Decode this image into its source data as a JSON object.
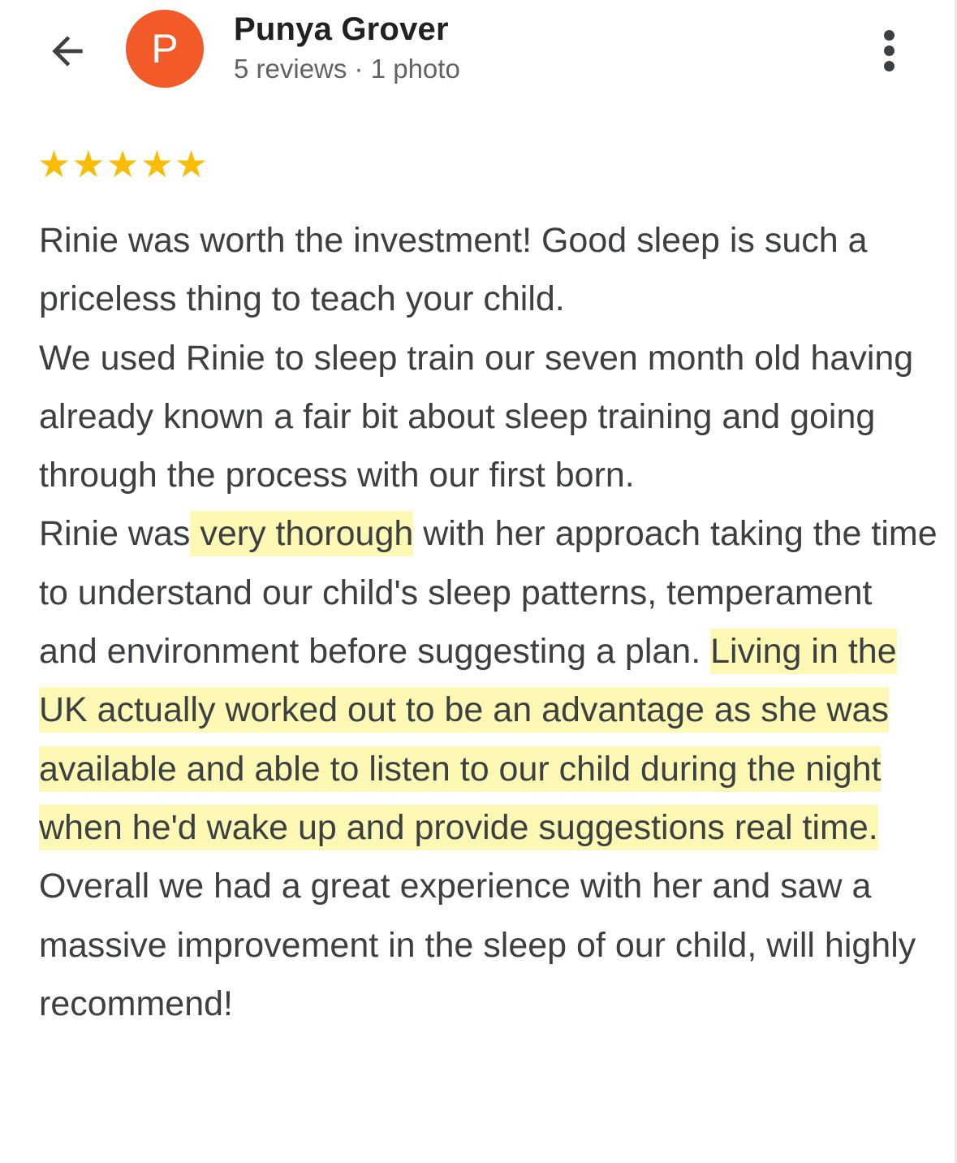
{
  "header": {
    "back_icon": "arrow-left-icon",
    "avatar_letter": "P",
    "avatar_color": "#f25a29",
    "author_name": "Punya Grover",
    "author_meta": "5 reviews · 1 photo",
    "more_icon": "more-vertical-icon"
  },
  "review": {
    "rating": 5,
    "rating_max": 5,
    "star_color": "#fbbc04",
    "highlight_color": "#fdf9b5",
    "p1": "Rinie was worth the investment! Good sleep is such a priceless thing to teach your child.",
    "p2": "We used Rinie to sleep train our seven month old having already known a fair bit about sleep training and going through the process with our first born.",
    "p3_a": "Rinie was",
    "p3_hl1": " very thorough",
    "p3_b": " with her approach taking the time to understand our child's sleep patterns, temperament and environment before suggesting a plan. ",
    "p3_hl2": "Living in the UK actually worked out to be an advantage as she was available and able to listen to our child during the night when he'd wake up and provide suggestions real time.",
    "p4": "Overall we had a great experience with her and saw a massive improvement in the sleep of our child, will highly recommend!"
  }
}
